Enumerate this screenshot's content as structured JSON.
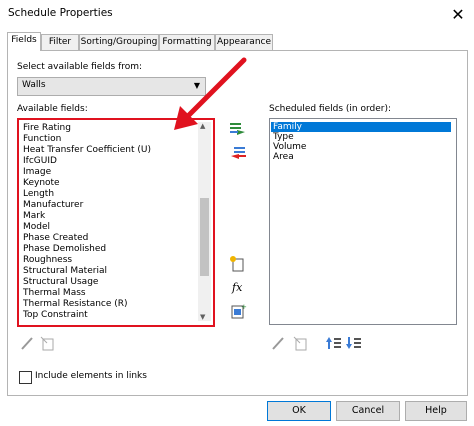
{
  "window": {
    "title": "Schedule Properties"
  },
  "tabs": [
    {
      "label": "Fields"
    },
    {
      "label": "Filter"
    },
    {
      "label": "Sorting/Grouping"
    },
    {
      "label": "Formatting"
    },
    {
      "label": "Appearance"
    }
  ],
  "fields": {
    "select_from_label": "Select available fields from:",
    "select_from_value": "Walls",
    "available_label": "Available fields:",
    "available": [
      "Fire Rating",
      "Function",
      "Heat Transfer Coefficient (U)",
      "IfcGUID",
      "Image",
      "Keynote",
      "Length",
      "Manufacturer",
      "Mark",
      "Model",
      "Phase Created",
      "Phase Demolished",
      "Roughness",
      "Structural Material",
      "Structural Usage",
      "Thermal Mass",
      "Thermal Resistance (R)",
      "Top Constraint"
    ],
    "scheduled_label": "Scheduled fields (in order):",
    "scheduled": [
      "Family",
      "Type",
      "Volume",
      "Area"
    ],
    "include_links_label": "Include elements in links"
  },
  "buttons": {
    "ok": "OK",
    "cancel": "Cancel",
    "help": "Help"
  },
  "colors": {
    "highlight": "#0078d7",
    "annotation_red": "#e0121f"
  }
}
